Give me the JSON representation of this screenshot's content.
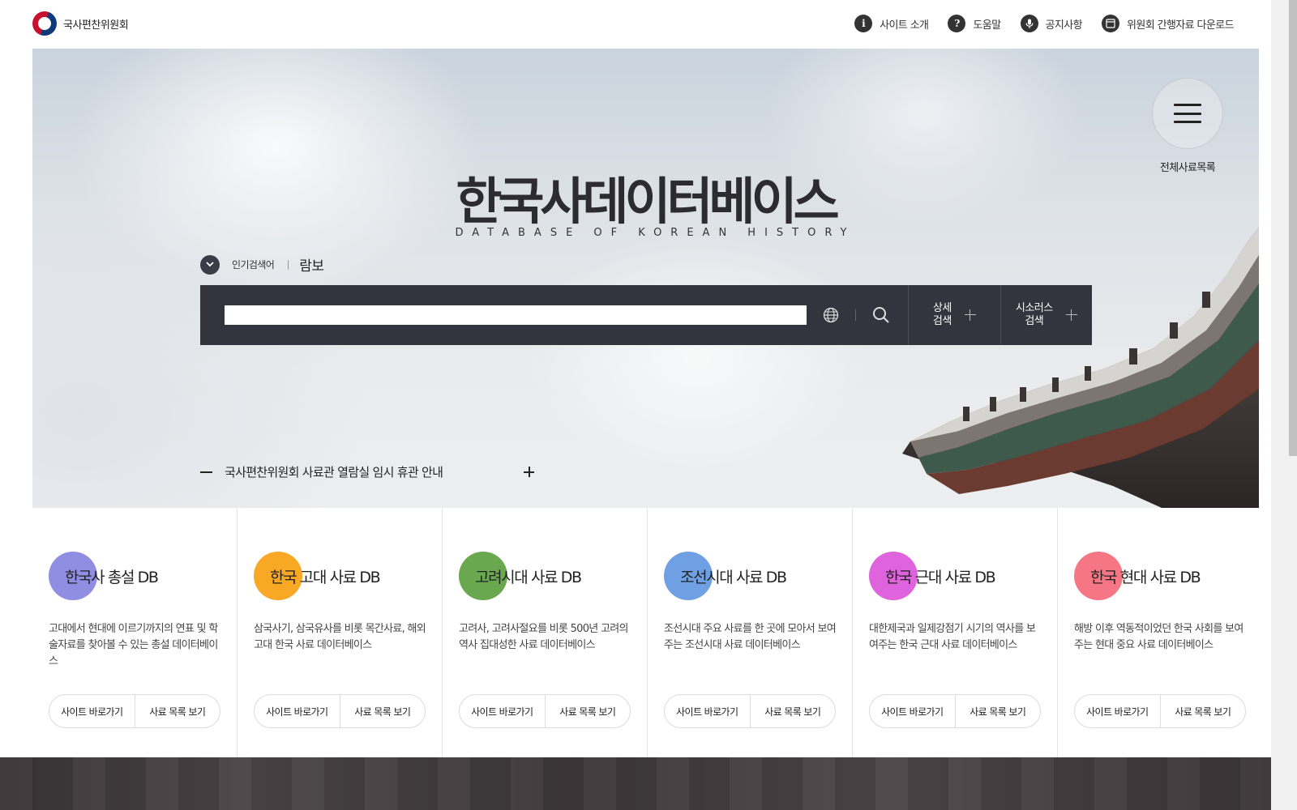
{
  "header": {
    "logo_text": "국사편찬위원회",
    "nav": [
      {
        "icon": "info-icon",
        "glyph": "i",
        "label": "사이트 소개"
      },
      {
        "icon": "help-icon",
        "glyph": "?",
        "label": "도움말"
      },
      {
        "icon": "microphone-icon",
        "glyph": "",
        "label": "공지사항"
      },
      {
        "icon": "document-icon",
        "glyph": "",
        "label": "위원회 간행자료 다운로드"
      }
    ]
  },
  "hero": {
    "title": "한국사데이터베이스",
    "subtitle": "DATABASE OF KOREAN HISTORY",
    "menu_label": "전체사료목록",
    "popular_label": "인기검색어",
    "popular_term": "람보",
    "search": {
      "value": "",
      "detail_label_1": "상세",
      "detail_label_2": "검색",
      "thesaurus_label_1": "시소러스",
      "thesaurus_label_2": "검색"
    },
    "notice": "국사편찬위원회 사료관 열람실 임시 휴관 안내"
  },
  "cards": [
    {
      "title": "한국사 총설 DB",
      "color": "#8f8ee2",
      "desc": "고대에서 현대에 이르기까지의 연표 및 학술자료를 찾아볼 수 있는 총설 데이터베이스",
      "btn1": "사이트 바로가기",
      "btn2": "사료 목록 보기"
    },
    {
      "title": "한국 고대 사료 DB",
      "color": "#f9a825",
      "desc": "삼국사기, 삼국유사를 비롯 목간사료, 해외 고대 한국 사료 데이터베이스",
      "btn1": "사이트 바로가기",
      "btn2": "사료 목록 보기"
    },
    {
      "title": "고려시대 사료 DB",
      "color": "#6aa84f",
      "desc": "고려사, 고려사절요를 비롯 500년 고려의 역사 집대성한 사료 데이터베이스",
      "btn1": "사이트 바로가기",
      "btn2": "사료 목록 보기"
    },
    {
      "title": "조선시대 사료 DB",
      "color": "#6fa0e3",
      "desc": "조선시대 주요 사료를 한 곳에 모아서 보여주는 조선시대 사료 데이터베이스",
      "btn1": "사이트 바로가기",
      "btn2": "사료 목록 보기"
    },
    {
      "title": "한국 근대 사료 DB",
      "color": "#df63dc",
      "desc": "대한제국과 일제강점기 시기의 역사를 보여주는 한국 근대 사료 데이터베이스",
      "btn1": "사이트 바로가기",
      "btn2": "사료 목록 보기"
    },
    {
      "title": "한국 현대 사료 DB",
      "color": "#f67685",
      "desc": "해방 이후 역동적이었던 한국 사회를 보여주는 현대 중요 사료 데이터베이스",
      "btn1": "사이트 바로가기",
      "btn2": "사료 목록 보기"
    }
  ]
}
